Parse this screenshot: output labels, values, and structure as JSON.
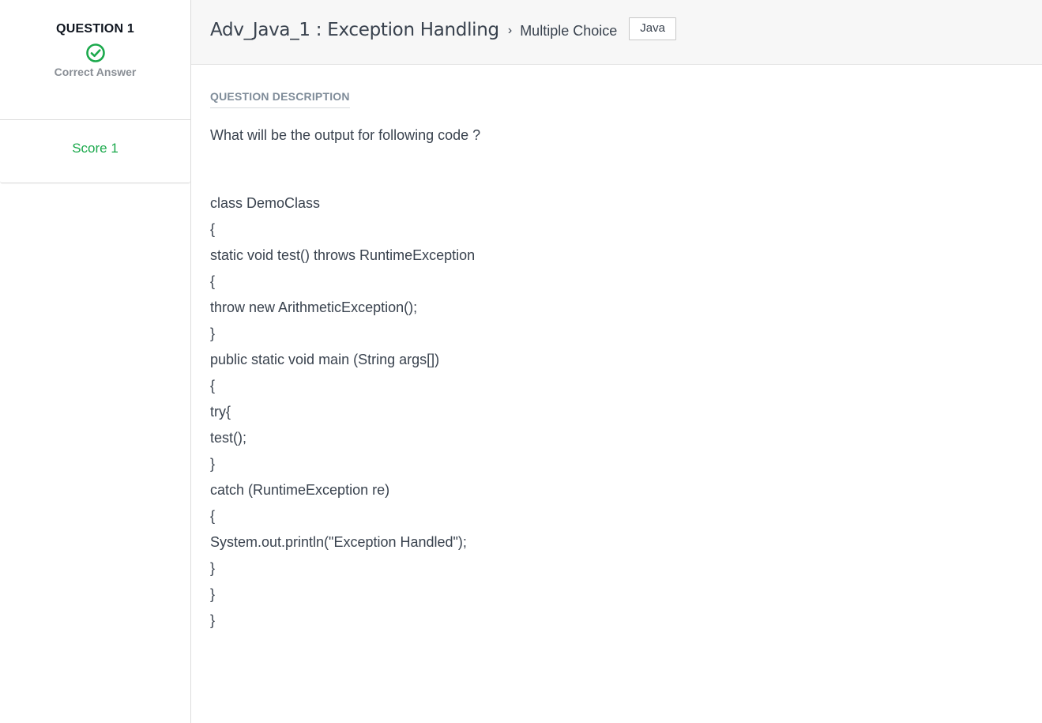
{
  "sidebar": {
    "question_label": "QUESTION 1",
    "status_icon": "check-circle-icon",
    "status_label": "Correct Answer",
    "status_color": "#1ba94c",
    "score_label": "Score 1"
  },
  "header": {
    "title": "Adv_Java_1 : Exception Handling",
    "separator_icon": "chevron-right-icon",
    "question_type": "Multiple Choice",
    "tag": "Java"
  },
  "content": {
    "section_label": "QUESTION DESCRIPTION",
    "prompt": "What will be the output for following code ?",
    "code_lines": [
      "class DemoClass",
      "{",
      "static void test() throws RuntimeException",
      "{",
      "throw new ArithmeticException();",
      "}",
      "public static void main (String args[])",
      "{",
      "try{",
      "test();",
      "}",
      "catch (RuntimeException re)",
      "{",
      "System.out.println(\"Exception Handled\");",
      "}",
      "}",
      "}"
    ]
  }
}
